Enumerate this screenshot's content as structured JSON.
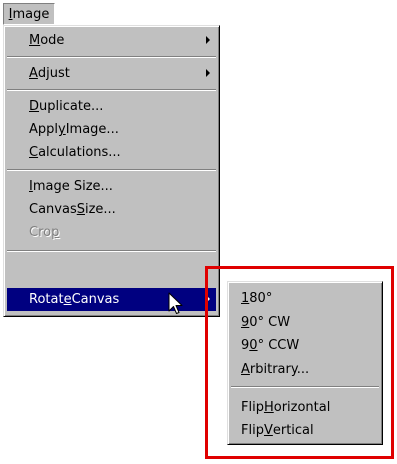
{
  "menubar": {
    "image_menu": {
      "label": "Image",
      "mnemonic": "I",
      "rest": "mage"
    }
  },
  "main_menu": {
    "items": [
      {
        "pre": "",
        "mn": "M",
        "post": "ode",
        "submenu": true
      },
      {
        "pre": "",
        "mn": "A",
        "post": "djust",
        "submenu": true
      },
      {
        "pre": "",
        "mn": "D",
        "post": "uplicate..."
      },
      {
        "pre": "Appl",
        "mn": "y",
        "post": " Image..."
      },
      {
        "pre": "",
        "mn": "C",
        "post": "alculations..."
      },
      {
        "pre": "",
        "mn": "I",
        "post": "mage Size..."
      },
      {
        "pre": "Canvas ",
        "mn": "S",
        "post": "ize..."
      },
      {
        "pre": "Cro",
        "mn": "p",
        "post": "",
        "disabled": true
      },
      {
        "pre": "Rotat",
        "mn": "e",
        "post": " Canvas",
        "submenu": true,
        "highlighted": true
      }
    ]
  },
  "rotate_submenu": {
    "items": [
      {
        "pre": "",
        "mn": "1",
        "post": "80°"
      },
      {
        "pre": "",
        "mn": "9",
        "post": "0°  CW"
      },
      {
        "pre": "9",
        "mn": "0",
        "post": "°  CCW"
      },
      {
        "pre": "",
        "mn": "A",
        "post": "rbitrary..."
      },
      {
        "pre": "Flip ",
        "mn": "H",
        "post": "orizontal"
      },
      {
        "pre": "Flip ",
        "mn": "V",
        "post": "ertical"
      }
    ]
  },
  "colors": {
    "menu_bg": "#c0c0c0",
    "highlight_bg": "#000080",
    "annotation_border": "#e00000"
  },
  "icons": {
    "cursor": "arrow-pointer-icon",
    "submenu": "triangle-right-icon"
  }
}
